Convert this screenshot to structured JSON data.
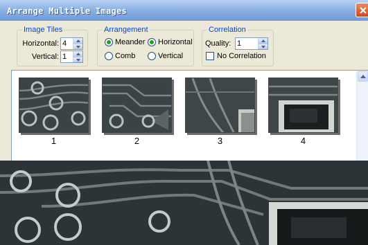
{
  "window": {
    "title": "Arrange Multiple Images"
  },
  "image_tiles": {
    "legend": "Image Tiles",
    "horizontal_label": "Horizontal:",
    "horizontal_value": "4",
    "vertical_label": "Vertical:",
    "vertical_value": "1"
  },
  "arrangement": {
    "legend": "Arrangement",
    "options": [
      {
        "label": "Meander",
        "selected": true
      },
      {
        "label": "Horizontal",
        "selected": true
      },
      {
        "label": "Comb",
        "selected": false
      },
      {
        "label": "Vertical",
        "selected": false
      }
    ]
  },
  "correlation": {
    "legend": "Correlation",
    "quality_label": "Quality:",
    "quality_value": "1",
    "no_correlation_label": "No Correlation",
    "no_correlation_checked": false
  },
  "preview": {
    "thumbnails": [
      {
        "number": "1"
      },
      {
        "number": "2"
      },
      {
        "number": "3"
      },
      {
        "number": "4"
      }
    ]
  },
  "colors": {
    "titlebar": "#8db2e3",
    "dialog_bg": "#ece9d8",
    "group_legend": "#0046d5",
    "radio_dot": "#21a121",
    "micrograph_dark": "#2b3336"
  },
  "icons": [
    "close-icon",
    "spin-up-icon",
    "spin-down-icon",
    "scroll-up-icon"
  ]
}
